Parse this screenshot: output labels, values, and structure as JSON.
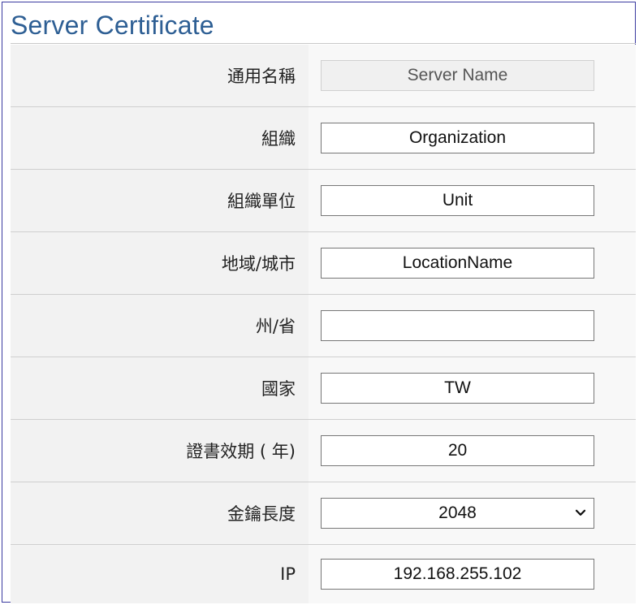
{
  "title": "Server Certificate",
  "rows": [
    {
      "label": "通用名稱",
      "value": "Server Name",
      "kind": "readonly"
    },
    {
      "label": "組織",
      "value": "Organization",
      "kind": "input"
    },
    {
      "label": "組織單位",
      "value": "Unit",
      "kind": "input"
    },
    {
      "label": "地域/城市",
      "value": "LocationName",
      "kind": "input"
    },
    {
      "label": "州/省",
      "value": "",
      "kind": "input"
    },
    {
      "label": "國家",
      "value": "TW",
      "kind": "input"
    },
    {
      "label": "證書效期 ( 年)",
      "value": "20",
      "kind": "input"
    },
    {
      "label": "金鑰長度",
      "value": "2048",
      "kind": "select"
    },
    {
      "label": "IP",
      "value": "192.168.255.102",
      "kind": "input"
    }
  ],
  "icons": {
    "select_arrow": "chevron-down-icon"
  },
  "colors": {
    "title": "#2e5f94",
    "label_bg": "#f2f2f2",
    "border": "#cfcfcf"
  }
}
